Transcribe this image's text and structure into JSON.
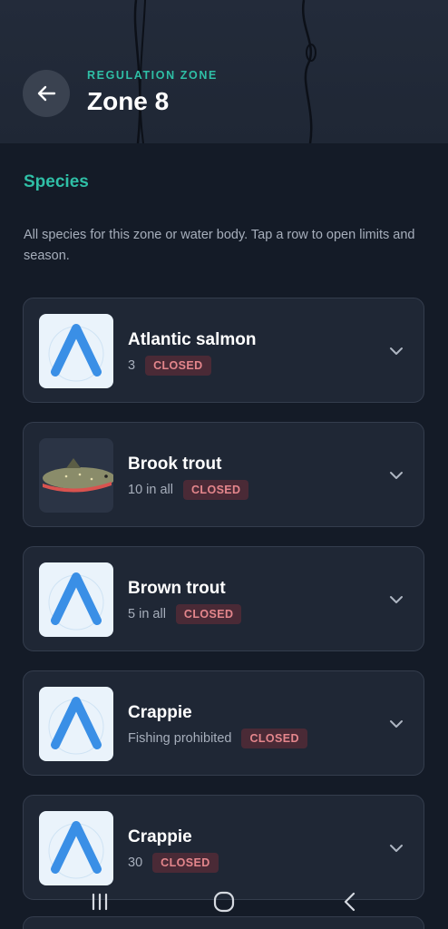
{
  "header": {
    "eyebrow": "REGULATION ZONE",
    "title": "Zone 8",
    "back_icon": "arrow-left-icon"
  },
  "section": {
    "title": "Species",
    "description": "All species for this zone or water body. Tap a row to open limits and season."
  },
  "species": [
    {
      "name": "Atlantic salmon",
      "limit": "3",
      "status": "CLOSED",
      "image": "placeholder-logo"
    },
    {
      "name": "Brook trout",
      "limit": "10 in all",
      "status": "CLOSED",
      "image": "fish-photo"
    },
    {
      "name": "Brown trout",
      "limit": "5 in all",
      "status": "CLOSED",
      "image": "placeholder-logo"
    },
    {
      "name": "Crappie",
      "limit": "Fishing prohibited",
      "status": "CLOSED",
      "image": "placeholder-logo"
    },
    {
      "name": "Crappie",
      "limit": "30",
      "status": "CLOSED",
      "image": "placeholder-logo"
    }
  ],
  "colors": {
    "accent": "#2fbfa6",
    "background": "#141b27",
    "card": "#1f2735",
    "closed_badge_text": "#e4868c",
    "closed_badge_bg": "#4a2a36"
  },
  "system_nav": [
    "recents-icon",
    "home-icon",
    "back-icon"
  ]
}
